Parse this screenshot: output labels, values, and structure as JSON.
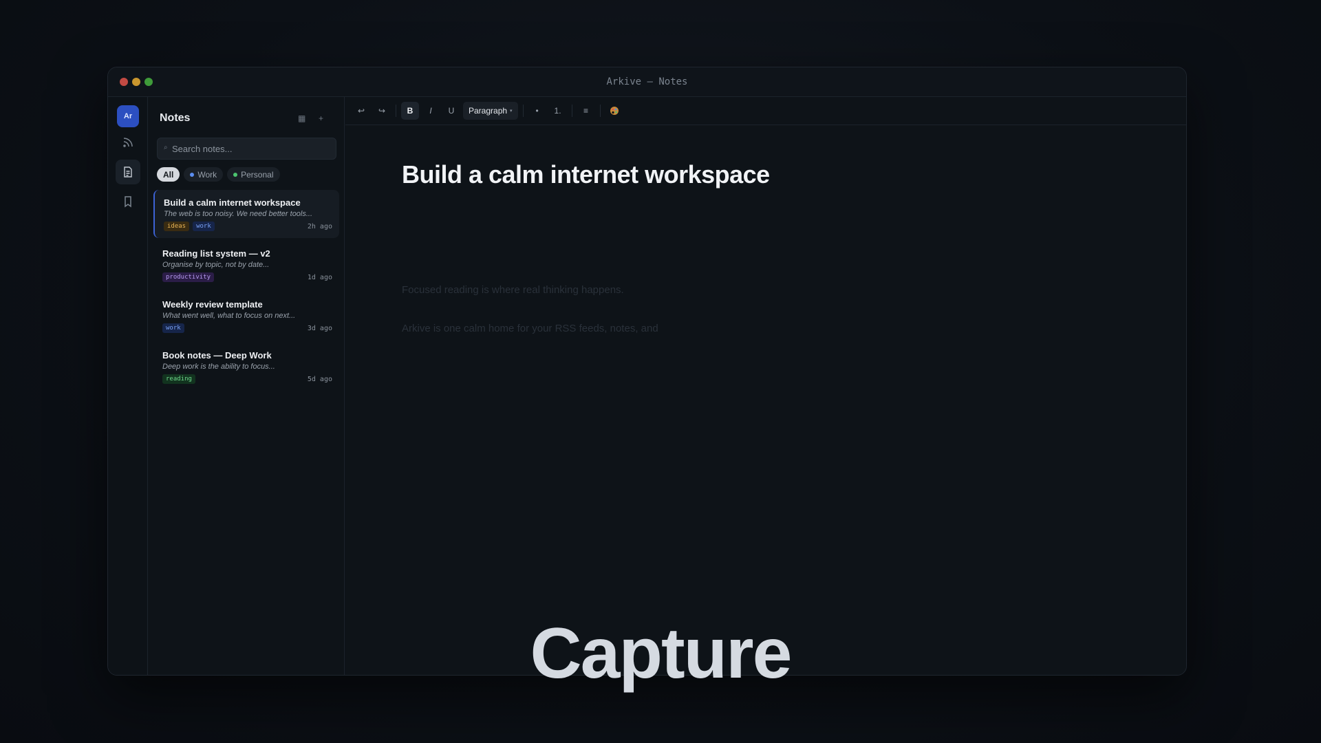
{
  "window": {
    "title": "Arkive — Notes"
  },
  "rail": {
    "logo_text": "Ar",
    "items": [
      {
        "icon": "rss-icon"
      },
      {
        "icon": "document-icon"
      },
      {
        "icon": "bookmark-icon"
      }
    ]
  },
  "notes_panel": {
    "title": "Notes",
    "search": {
      "placeholder": "Search notes...",
      "value": ""
    },
    "filters": [
      {
        "label": "All",
        "active": true
      },
      {
        "label": "Work",
        "color": "#5b8def"
      },
      {
        "label": "Personal",
        "color": "#4cc46f"
      }
    ],
    "notes": [
      {
        "title": "Build a calm internet workspace",
        "snippet": "The web is too noisy. We need better tools...",
        "tags": [
          "ideas",
          "work"
        ],
        "time": "2h ago",
        "active": true
      },
      {
        "title": "Reading list system — v2",
        "snippet": "Organise by topic, not by date...",
        "tags": [
          "productivity"
        ],
        "time": "1d ago"
      },
      {
        "title": "Weekly review template",
        "snippet": "What went well, what to focus on next...",
        "tags": [
          "work"
        ],
        "time": "3d ago"
      },
      {
        "title": "Book notes — Deep Work",
        "snippet": "Deep work is the ability to focus...",
        "tags": [
          "reading"
        ],
        "time": "5d ago"
      }
    ]
  },
  "toolbar": {
    "undo": "↩",
    "redo": "↪",
    "bold": "B",
    "italic": "I",
    "underline": "U",
    "block_type": "Paragraph",
    "bullet_list": "•",
    "numbered_list": "1.",
    "align": "≡",
    "color_icon": "palette-icon"
  },
  "document": {
    "title": "Build a calm internet workspace",
    "paragraphs": [
      "Focused reading is where real thinking happens.",
      "Arkive is one calm home for your RSS feeds, notes, and"
    ]
  },
  "caption": "Capture",
  "colors": {
    "accent": "#2c4fc0",
    "active_border": "#3d63d6"
  }
}
